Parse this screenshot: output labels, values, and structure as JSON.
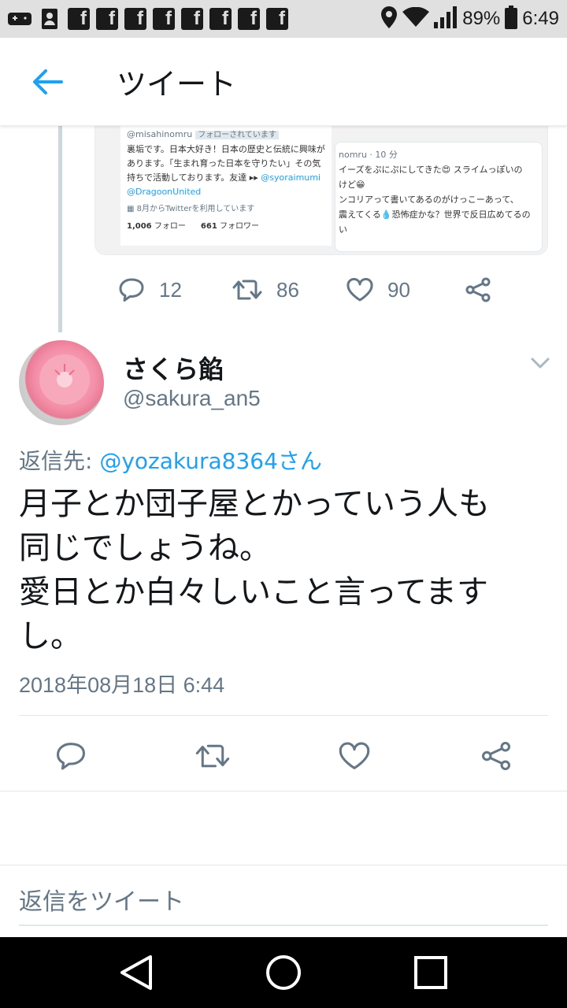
{
  "status_bar": {
    "battery": "89%",
    "time": "6:49",
    "fb_letter": "f"
  },
  "header": {
    "title": "ツイート"
  },
  "quoted_media": {
    "card1": {
      "handle": "@misahinomru",
      "follows_badge": "フォローされています",
      "bio_line1": "裏垢です。日本大好き！日本の歴史と伝統に興味が",
      "bio_line2": "あります。「生まれ育った日本を守りたい」その気",
      "bio_line3": "持ちで活動しております。友達 ▸▸ ",
      "bio_link1": "@syoraimumi",
      "bio_link2": "@DragoonUnited",
      "joined": "8月からTwitterを利用しています",
      "following_count": "1,006",
      "following_label": "フォロー",
      "followers_count": "661",
      "followers_label": "フォロワー"
    },
    "card2": {
      "meta": "nomru · 10 分",
      "line1": "イーズをぷにぷにしてきた😍 スライムっぽいの",
      "line2": "けど😁",
      "line3": "ンコリアって書いてあるのがけっこーあって、",
      "line4": "震えてくる💧恐怖症かな？世界で反日広めてるの",
      "line5": "い"
    }
  },
  "prev_tweet_actions": {
    "reply_count": "12",
    "retweet_count": "86",
    "like_count": "90"
  },
  "tweet": {
    "author_name": "さくら餡",
    "author_handle": "@sakura_an5",
    "reply_prefix": "返信先: ",
    "reply_mention": "@yozakura8364さん",
    "text": "月子とか団子屋とかっていう人も\n同じでしょうね。\n愛日とか白々しいこと言ってます\nし。",
    "timestamp": "2018年08月18日 6:44"
  },
  "reply_box": {
    "placeholder": "返信をツイート"
  },
  "colors": {
    "accent": "#1da1f2",
    "muted": "#657786",
    "text": "#14171a",
    "divider": "#e1e8ed"
  }
}
